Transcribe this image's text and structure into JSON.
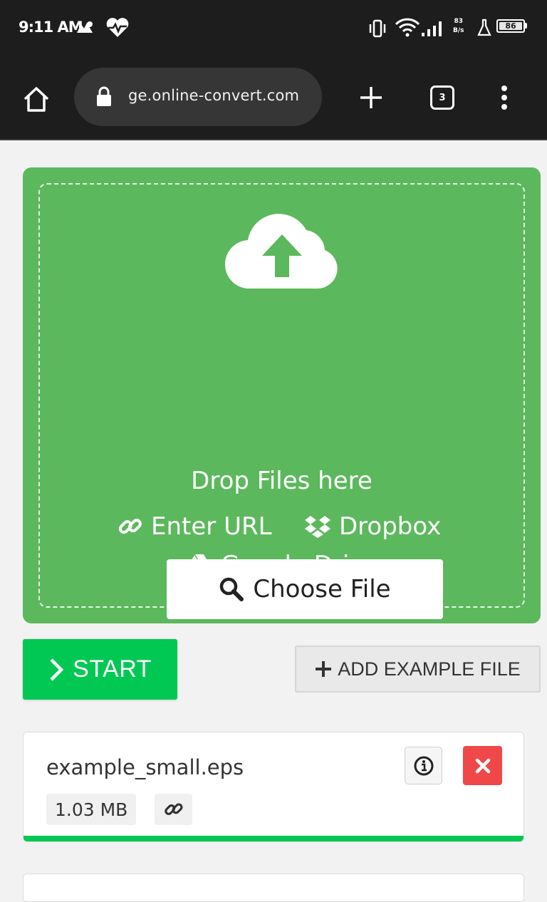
{
  "status_bar": {
    "time": "9:11 AM",
    "net_speed_value": "83",
    "net_speed_unit": "B/s",
    "battery": "86"
  },
  "browser": {
    "url": "ge.online-convert.com",
    "tab_count": "3"
  },
  "dropzone": {
    "drop_label": "Drop Files here",
    "choose_file_label": "Choose File",
    "enter_url_label": "Enter URL",
    "dropbox_label": "Dropbox",
    "google_drive_label": "Google Drive"
  },
  "actions": {
    "start_label": "START",
    "add_example_label": "ADD EXAMPLE FILE"
  },
  "file": {
    "name": "example_small.eps",
    "size": "1.03 MB",
    "upload_progress": 1.0
  },
  "colors": {
    "dropzone": "#5cb85c",
    "start": "#00c853",
    "remove": "#f04848",
    "progress": "#00c853"
  }
}
